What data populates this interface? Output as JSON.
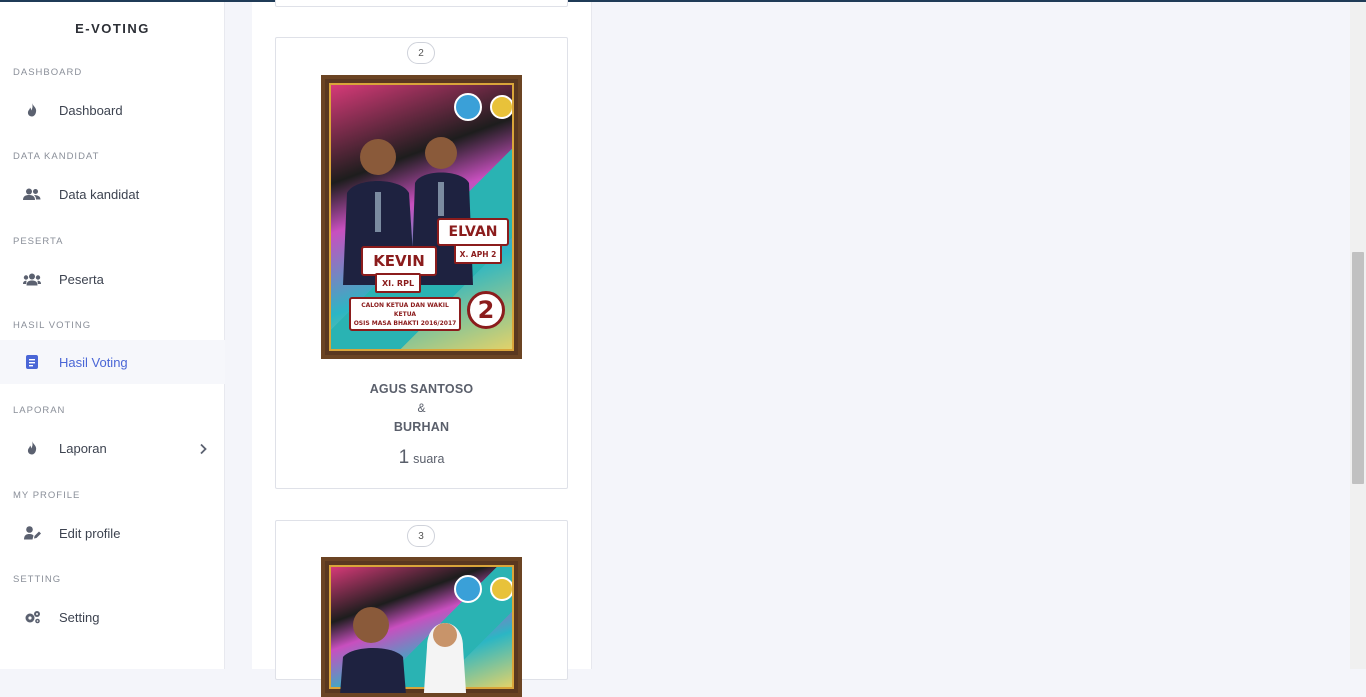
{
  "app": {
    "brand": "E-VOTING"
  },
  "sidebar": {
    "sections": [
      {
        "label": "DASHBOARD",
        "item": "Dashboard"
      },
      {
        "label": "DATA KANDIDAT",
        "item": "Data kandidat"
      },
      {
        "label": "PESERTA",
        "item": "Peserta"
      },
      {
        "label": "HASIL VOTING",
        "item": "Hasil Voting"
      },
      {
        "label": "LAPORAN",
        "item": "Laporan"
      },
      {
        "label": "MY PROFILE",
        "item": "Edit profile"
      },
      {
        "label": "SETTING",
        "item": "Setting"
      }
    ],
    "active_item": "Hasil Voting"
  },
  "candidates": [
    {
      "number": "2",
      "name_1": "AGUS SANTOSO",
      "conjunction": "&",
      "name_2": "BURHAN",
      "votes": "1",
      "votes_unit": "suara",
      "poster": {
        "name_left": "KEVIN",
        "class_left": "XI. RPL",
        "name_right": "ELVAN",
        "class_right": "X. APH 2",
        "caption_line1": "CALON KETUA DAN WAKIL KETUA",
        "caption_line2": "OSIS MASA BHAKTI 2016/2017",
        "big_number": "2"
      }
    },
    {
      "number": "3"
    }
  ],
  "colors": {
    "accent": "#4a66d6",
    "top_line": "#1f3b57"
  }
}
